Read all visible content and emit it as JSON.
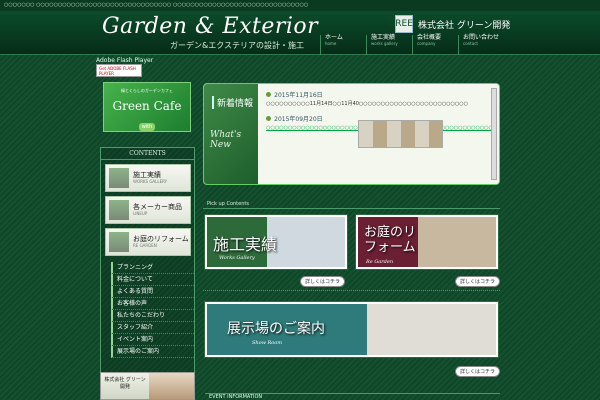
{
  "header": {
    "logo": "Garden & Exterior",
    "tagline": "ガーデン&エクステリアの設計・施工",
    "company_mark": "GREEN",
    "company_name": "株式会社 グリーン開発"
  },
  "nav": [
    {
      "label": "ホーム",
      "en": "home"
    },
    {
      "label": "施工実績",
      "en": "works gallery"
    },
    {
      "label": "会社概要",
      "en": "company"
    },
    {
      "label": "お問い合わせ",
      "en": "contact"
    }
  ],
  "flash": {
    "label": "Adobe Flash Player",
    "badge": "Get ADOBE FLASH PLAYER"
  },
  "sidebar": {
    "greencafe_small": "緑とくらしのガーデンカフェ",
    "greencafe_big": "Green Cafe",
    "greencafe_cafe": "with",
    "contents_title": "CONTENTS",
    "buttons": [
      {
        "label": "施工実績",
        "en": "WORKS GALLERY"
      },
      {
        "label": "各メーカー商品",
        "en": "LINEUP"
      },
      {
        "label": "お庭のリフォーム",
        "en": "RE GARDEN"
      }
    ],
    "links": [
      "プランニング",
      "料金について",
      "よくある質問",
      "お客様の声",
      "私たちのこだわり",
      "スタッフ紹介",
      "イベント案内",
      "展示場のご案内"
    ],
    "company_box": "株式会社 グリーン開発"
  },
  "news": {
    "title_jp": "新着情報",
    "title_en": "What's New",
    "items": [
      {
        "date": "2015年11月16日",
        "text": "○○○○○○○○○○11月14日○○11月40○○○○○○○○○○○○○○○○○○○○○○○○○"
      },
      {
        "date": "2015年09月20日",
        "text": "○○○○○○○○○○○○○○○○○○○○○○○○○○○○○○○○○○○○○○○○○○○○○○○○○○○○"
      }
    ]
  },
  "pickup": {
    "title": "Pick up Contents",
    "more": "詳しくはコチラ"
  },
  "banners": [
    {
      "jp": "施工実績",
      "en": "Works Gallery"
    },
    {
      "jp": "お庭のリフォーム",
      "en": "Re Garden"
    },
    {
      "jp": "展示場のご案内",
      "en": "Show Room"
    }
  ],
  "bottom_head": "EVENT INFORMATION"
}
